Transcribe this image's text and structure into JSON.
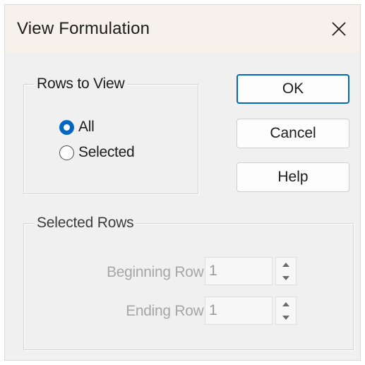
{
  "dialog": {
    "title": "View Formulation",
    "close_icon": "close-icon"
  },
  "rows_to_view": {
    "legend": "Rows to View",
    "options": [
      {
        "label": "All",
        "checked": true
      },
      {
        "label": "Selected",
        "checked": false
      }
    ]
  },
  "buttons": {
    "ok": "OK",
    "cancel": "Cancel",
    "help": "Help"
  },
  "selected_rows": {
    "legend": "Selected Rows",
    "enabled": false,
    "beginning_label": "Beginning Row:",
    "beginning_value": "1",
    "ending_label": "Ending Row:",
    "ending_value": "1"
  },
  "colors": {
    "accent": "#0067c0",
    "titlebar": "#f6f1ea",
    "dialog_bg": "#f0f0f0",
    "disabled_text": "#a6a6a6"
  }
}
